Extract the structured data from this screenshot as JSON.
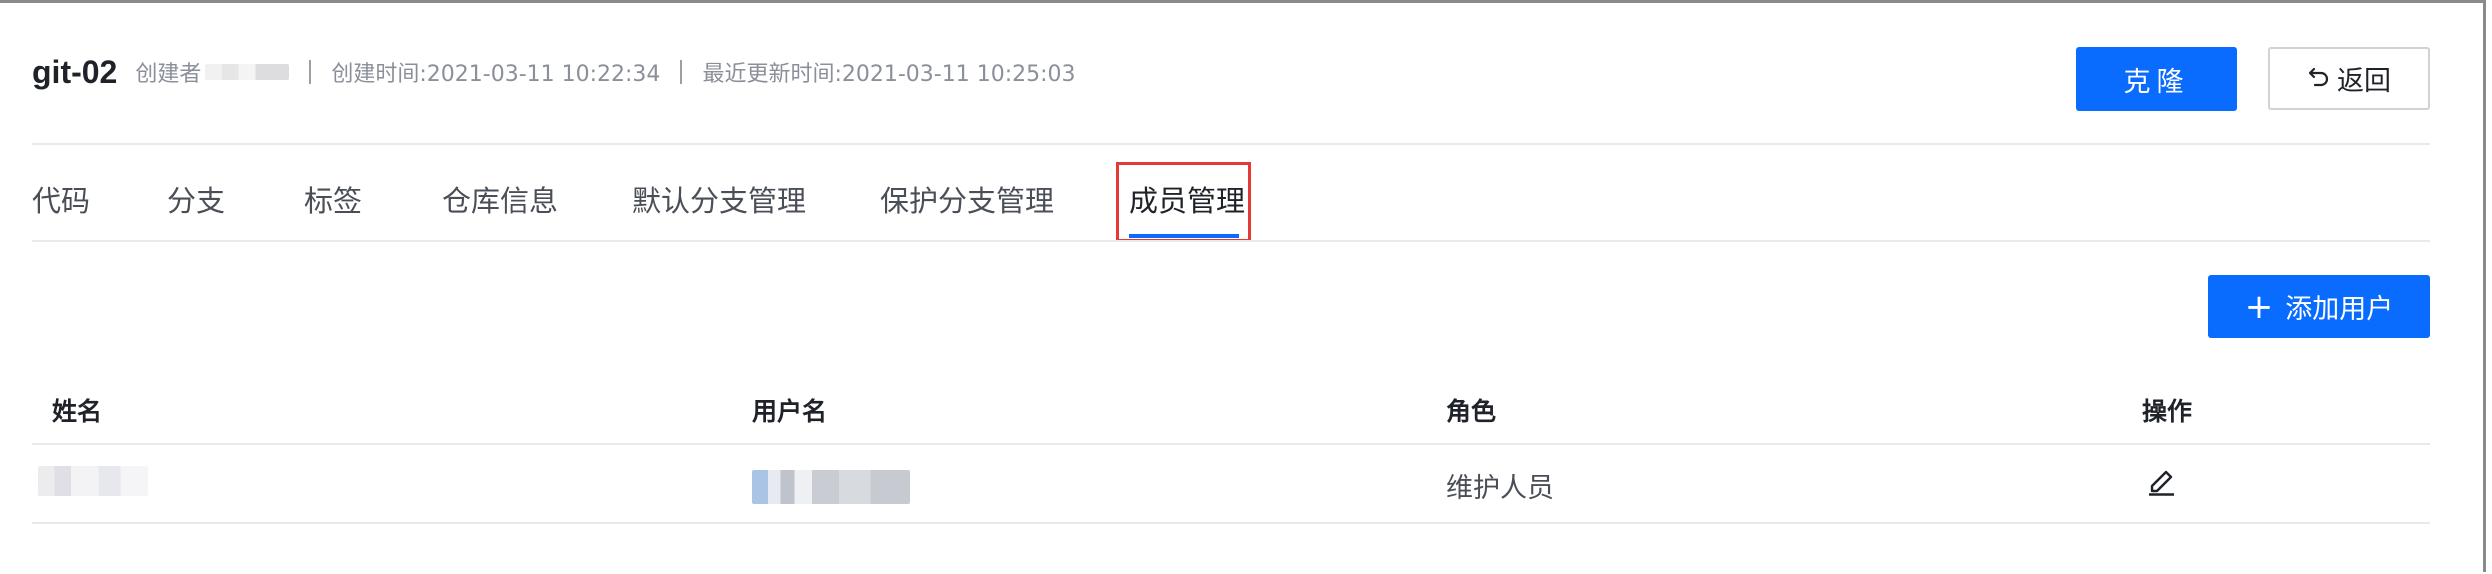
{
  "header": {
    "repo_name": "git-02",
    "creator_label": "创建者",
    "created_at": "创建时间:2021-03-11 10:22:34",
    "updated_at": "最近更新时间:2021-03-11 10:25:03"
  },
  "actions": {
    "clone_label": "克隆",
    "back_label": "返回",
    "back_icon": "undo-arrow-icon"
  },
  "tabs": [
    {
      "label": "代码"
    },
    {
      "label": "分支"
    },
    {
      "label": "标签"
    },
    {
      "label": "仓库信息"
    },
    {
      "label": "默认分支管理"
    },
    {
      "label": "保护分支管理"
    },
    {
      "label": "成员管理",
      "active": true
    }
  ],
  "members": {
    "add_user_label": "添加用户",
    "columns": [
      "姓名",
      "用户名",
      "角色",
      "操作"
    ],
    "rows": [
      {
        "role": "维护人员"
      }
    ]
  },
  "colors": {
    "primary": "#0a6cff",
    "highlight_border": "#e53935"
  }
}
